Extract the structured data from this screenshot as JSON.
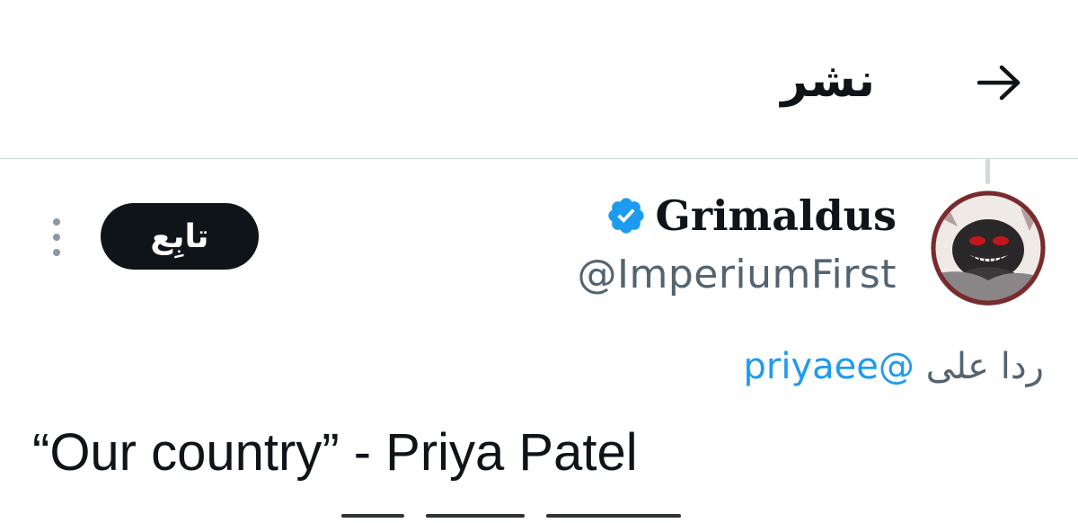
{
  "header": {
    "title": "نشر",
    "back_icon": "arrow-right-icon"
  },
  "tweet": {
    "author": {
      "display_name": "Grimaldus",
      "handle": "@ImperiumFirst",
      "verified": true,
      "verified_color": "#1d9bf0"
    },
    "follow_label": "تابِع",
    "more_icon": "more-vertical-icon",
    "reply_to": {
      "prefix": "ردا على",
      "mention": "@priyaee"
    },
    "text": "“Our country” - Priya Patel"
  },
  "colors": {
    "accent": "#1d9bf0",
    "text_primary": "#0f1419",
    "text_secondary": "#536471",
    "divider": "#cfd9de"
  }
}
